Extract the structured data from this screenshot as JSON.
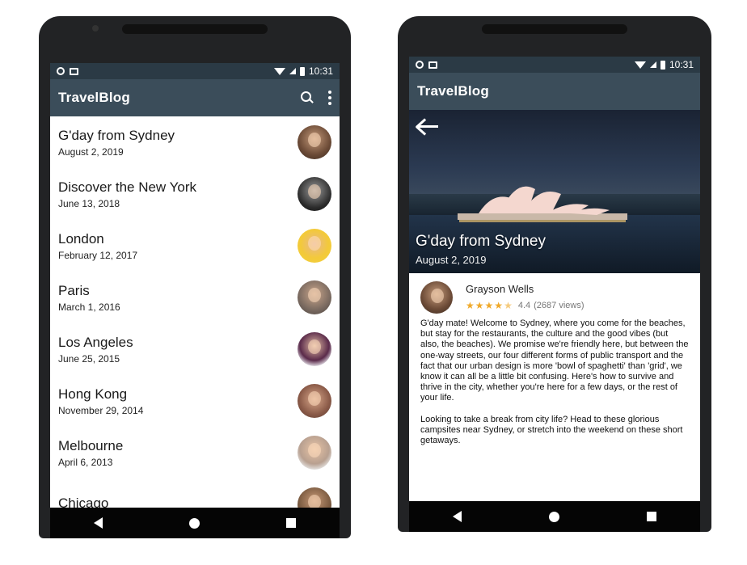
{
  "status_bar": {
    "time": "10:31"
  },
  "app": {
    "title": "TravelBlog"
  },
  "icons": {
    "search": "search-icon",
    "more": "more-vert-icon",
    "back": "arrow-back-icon",
    "star": "star-icon"
  },
  "colors": {
    "appbar": "#3b4d5a",
    "statusbar": "#2b3a45",
    "star": "#f0a92a"
  },
  "blog_list": [
    {
      "title": "G'day from Sydney",
      "date": "August 2, 2019"
    },
    {
      "title": "Discover the New York",
      "date": "June 13, 2018"
    },
    {
      "title": "London",
      "date": "February 12, 2017"
    },
    {
      "title": "Paris",
      "date": "March 1, 2016"
    },
    {
      "title": "Los Angeles",
      "date": "June 25, 2015"
    },
    {
      "title": "Hong Kong",
      "date": "November 29, 2014"
    },
    {
      "title": "Melbourne",
      "date": "April 6, 2013"
    },
    {
      "title": "Chicago",
      "date": ""
    }
  ],
  "detail": {
    "title": "G'day from Sydney",
    "date": "August 2, 2019",
    "author": "Grayson Wells",
    "rating": "4.4",
    "rating_stars": 4.5,
    "views": "(2687 views)",
    "paragraphs": [
      "G'day mate! Welcome to Sydney, where you come for the beaches, but stay for the restaurants, the culture and the good vibes (but also, the beaches). We promise we're friendly here, but between the one-way streets, our four different forms of public transport and the fact that our urban design is more 'bowl of spaghetti' than 'grid', we know it can all be a little bit confusing. Here's how to survive and thrive in the city, whether you're here for a few days, or the rest of your life.",
      "Looking to take a break from city life? Head to these glorious campsites near Sydney, or stretch into the weekend on these short getaways."
    ]
  }
}
